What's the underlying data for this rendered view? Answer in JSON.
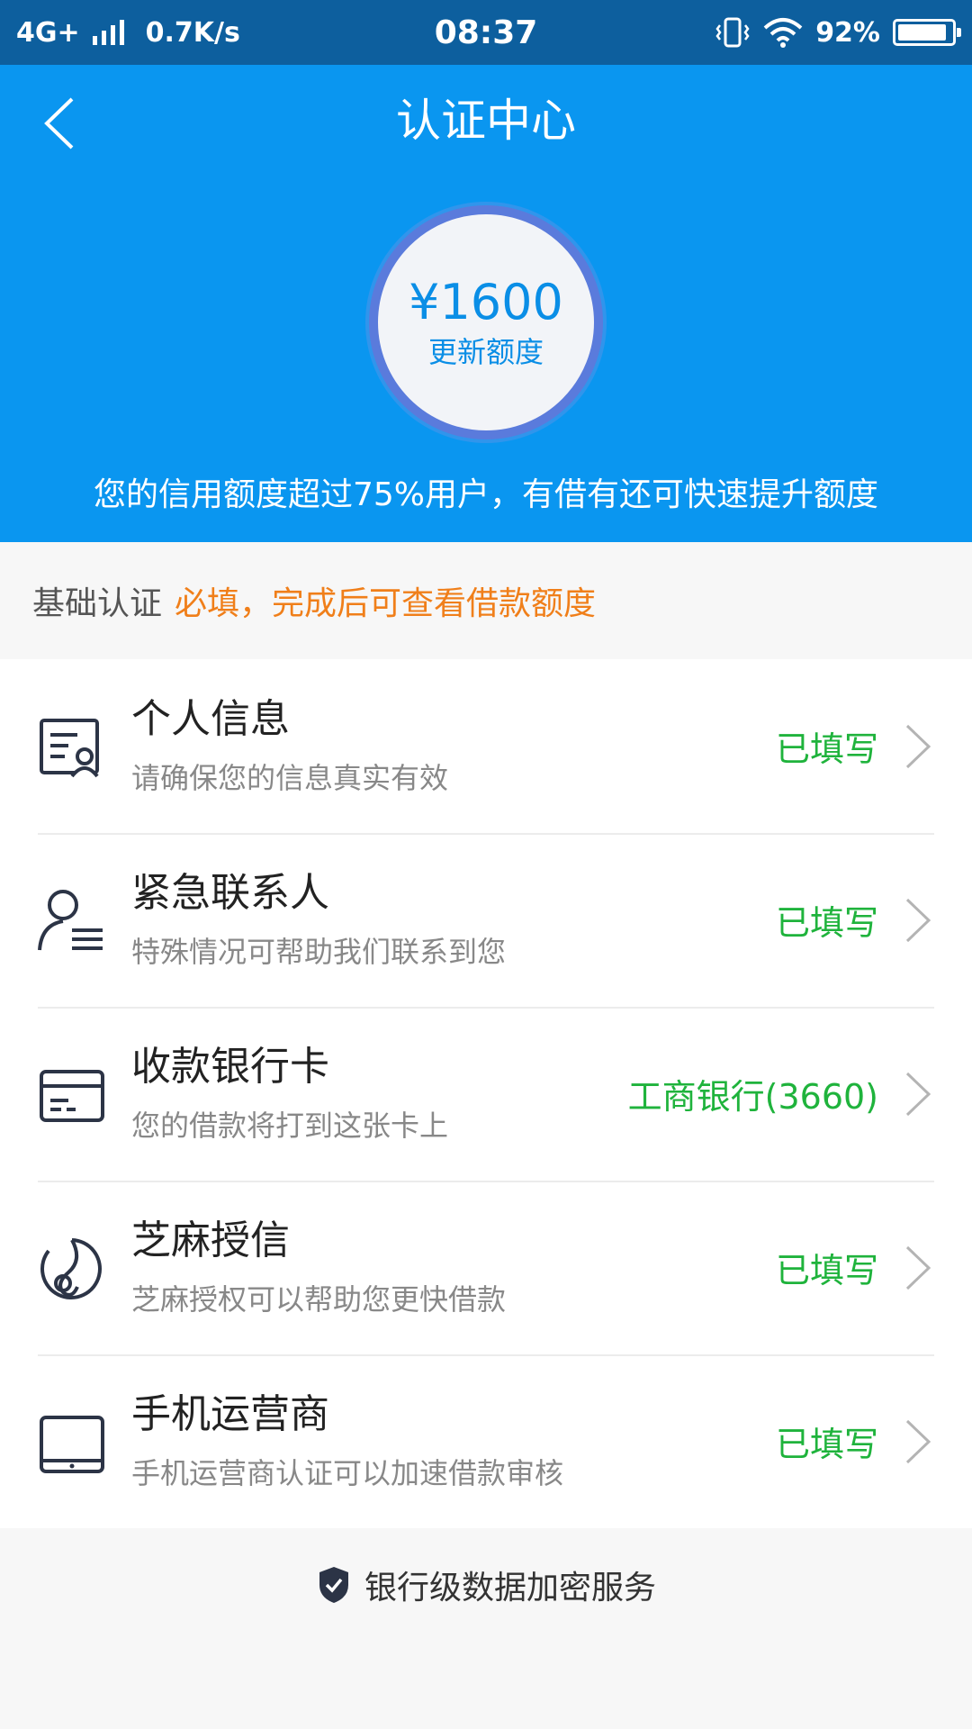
{
  "status_bar": {
    "network": "4G+",
    "speed": "0.7K/s",
    "time": "08:37",
    "battery": "92%",
    "battery_level": 0.92
  },
  "header": {
    "title": "认证中心",
    "credit_amount": "¥1600",
    "credit_action": "更新额度",
    "credit_note": "您的信用额度超过75%用户，有借有还可快速提升额度"
  },
  "section": {
    "label": "基础认证",
    "required_text": "必填，完成后可查看借款额度"
  },
  "items": [
    {
      "title": "个人信息",
      "desc": "请确保您的信息真实有效",
      "status": "已填写",
      "icon": "id-card-icon"
    },
    {
      "title": "紧急联系人",
      "desc": "特殊情况可帮助我们联系到您",
      "status": "已填写",
      "icon": "contact-person-icon"
    },
    {
      "title": "收款银行卡",
      "desc": "您的借款将打到这张卡上",
      "status": "工商银行(3660)",
      "icon": "bank-card-icon"
    },
    {
      "title": "芝麻授信",
      "desc": "芝麻授权可以帮助您更快借款",
      "status": "已填写",
      "icon": "sesame-icon"
    },
    {
      "title": "手机运营商",
      "desc": "手机运营商认证可以加速借款审核",
      "status": "已填写",
      "icon": "phone-icon"
    }
  ],
  "footer": {
    "text": "银行级数据加密服务",
    "icon": "shield-check-icon"
  },
  "colors": {
    "primary": "#0a96f0",
    "status_bar": "#0d5f9e",
    "accent_orange": "#f07f1a",
    "status_green": "#1fb33c"
  }
}
